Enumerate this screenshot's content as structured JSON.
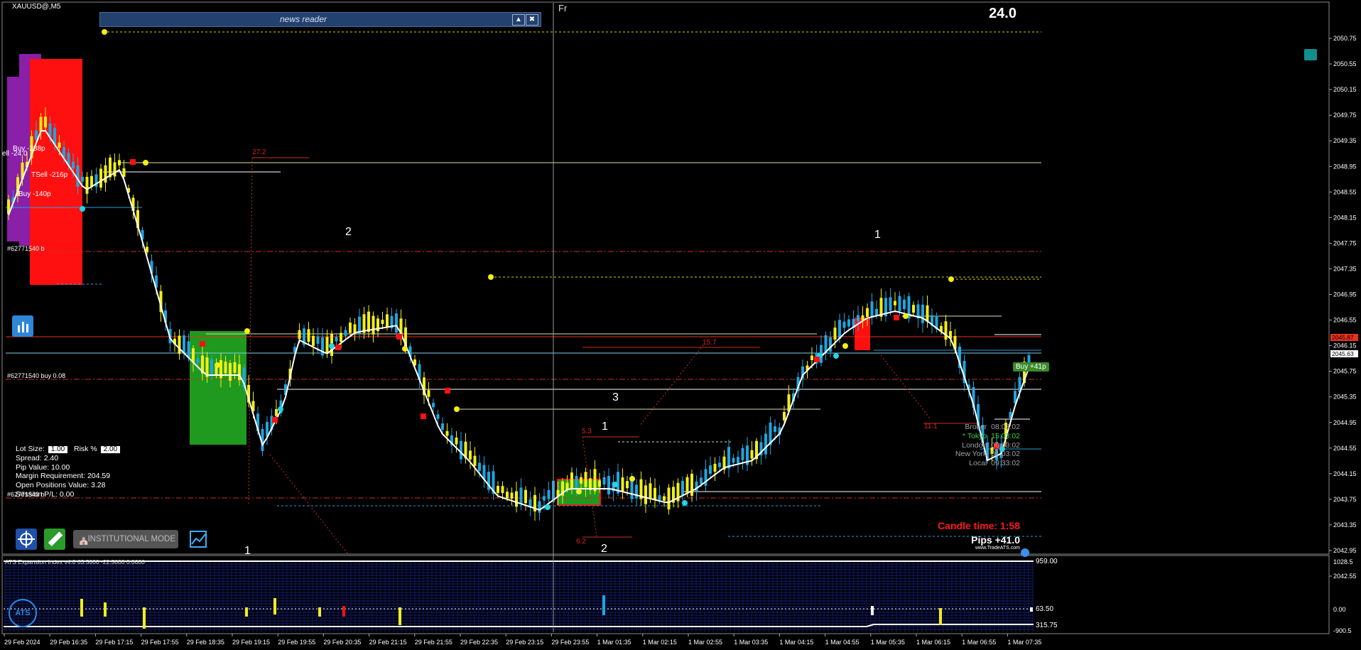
{
  "window": {
    "symbol": "XAUUSD@,M5",
    "spread_display": "24.0",
    "session_marker": "Fr"
  },
  "news_reader": {
    "title": "news reader",
    "collapse_icon": "triangle-up-icon",
    "close_icon": "close-box-icon"
  },
  "price_axis": {
    "labels": [
      "2050.75",
      "2050.55",
      "2050.15",
      "2049.75",
      "2049.35",
      "2048.95",
      "2048.55",
      "2048.15",
      "2047.75",
      "2047.35",
      "2046.95",
      "2046.55",
      "2046.15",
      "2045.75",
      "2045.35",
      "2044.95",
      "2044.55",
      "2044.15",
      "2043.75",
      "2043.35",
      "2042.95",
      "2042.55"
    ],
    "ask_tag": "2045.87",
    "ask_color": "#e8321e",
    "bid_tag": "2045.63",
    "bid_color": "#ffffff"
  },
  "time_axis": {
    "labels": [
      "29 Feb 2024",
      "29 Feb 16:35",
      "29 Feb 17:15",
      "29 Feb 17:55",
      "29 Feb 18:35",
      "29 Feb 19:15",
      "29 Feb 19:55",
      "29 Feb 20:35",
      "29 Feb 21:15",
      "29 Feb 21:55",
      "29 Feb 22:35",
      "29 Feb 23:15",
      "29 Feb 23:55",
      "1 Mar 01:35",
      "1 Mar 02:15",
      "1 Mar 02:55",
      "1 Mar 03:35",
      "1 Mar 04:15",
      "1 Mar 04:55",
      "1 Mar 05:35",
      "1 Mar 06:15",
      "1 Mar 06:55",
      "1 Mar 07:35"
    ]
  },
  "chart_labels": {
    "wave": [
      "2",
      "1",
      "3",
      "1",
      "2",
      "1",
      "1"
    ],
    "fib": [
      "27.2",
      "15.7",
      "5.3",
      "6.2",
      "11.1"
    ],
    "trades": [
      "Buy -288p",
      "ell -24.0",
      "TSell -216p",
      "Buy -140p",
      "#62771540 b",
      "#62771540 buy 0.08",
      "#62771540 b"
    ],
    "buy_tag": "Buy +41p"
  },
  "account_info": {
    "lot_size_label": "Lot Size:",
    "lot_size": "1.00",
    "risk_label": "Risk %",
    "risk": "2.00",
    "spread": "Spread: 2.40",
    "pip_value": "Pip Value: 10.00",
    "margin": "Margin Requirement: 204.59",
    "open_positions": "Open Positions Value: 3.28",
    "session_pl": "Session P/L: 0.00"
  },
  "clocks": [
    {
      "name": "Broker",
      "time": "08:03:02"
    },
    {
      "name": "* Tokyo",
      "time": "15:03:02"
    },
    {
      "name": "London",
      "time": "06:03:02"
    },
    {
      "name": "New York",
      "time": "01:03:02"
    },
    {
      "name": "Local",
      "time": "09:33:02"
    }
  ],
  "candle_time": "Candle time:  1:58",
  "pips": "Pips +41.0",
  "tradeats": "www.TradeATS.com",
  "toolbar": {
    "target_icon": "crosshair-target-icon",
    "ruler_icon": "ruler-icon",
    "institutional_label": "INSTITUTIONAL MODE",
    "chart_icon": "chart-trend-icon"
  },
  "indicator": {
    "title": "ATS Expansion Index v4.0 63.5000 -22.5000 0.0000",
    "value_top": "959.00",
    "value_mid": "63.50",
    "value_bot": "315.75",
    "axis": [
      "1028.5",
      "0.00",
      "-900.5"
    ],
    "logo": "ATS"
  },
  "colors": {
    "bull": "#1fa5e0",
    "bear": "#f2ee17",
    "ma": "#ffffff",
    "buy_zone": "#1f9a1f",
    "sell_zone": "#ff1010",
    "purple_zone": "#8a1fa8",
    "dash_red": "#c8321e",
    "cyan_dot": "#24d3e8"
  }
}
